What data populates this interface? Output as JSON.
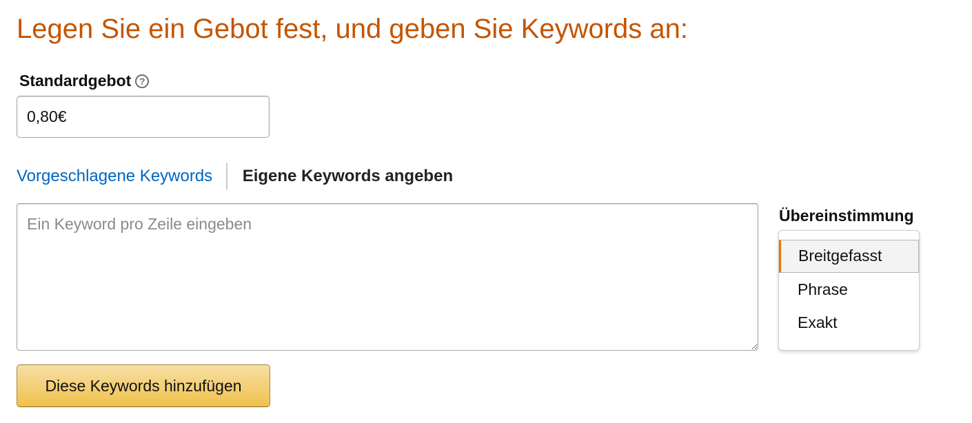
{
  "heading": "Legen Sie ein Gebot fest, und geben Sie Keywords an:",
  "bid": {
    "label": "Standardgebot",
    "help_icon": "question-circle-icon",
    "value": "0,80€"
  },
  "tabs": {
    "suggested_label": "Vorgeschlagene Keywords",
    "custom_label": "Eigene Keywords angeben",
    "active": "custom"
  },
  "keywords_input": {
    "placeholder": "Ein Keyword pro Zeile eingeben",
    "value": ""
  },
  "match_type": {
    "label": "Übereinstimmung",
    "options": [
      "Breitgefasst",
      "Phrase",
      "Exakt"
    ],
    "selected": "Breitgefasst"
  },
  "add_button_label": "Diese Keywords hinzufügen",
  "colors": {
    "heading": "#c45500",
    "link": "#0066c0",
    "button_top": "#f7dfa5",
    "button_bottom": "#f0c14b",
    "selected_accent": "#e77600"
  }
}
